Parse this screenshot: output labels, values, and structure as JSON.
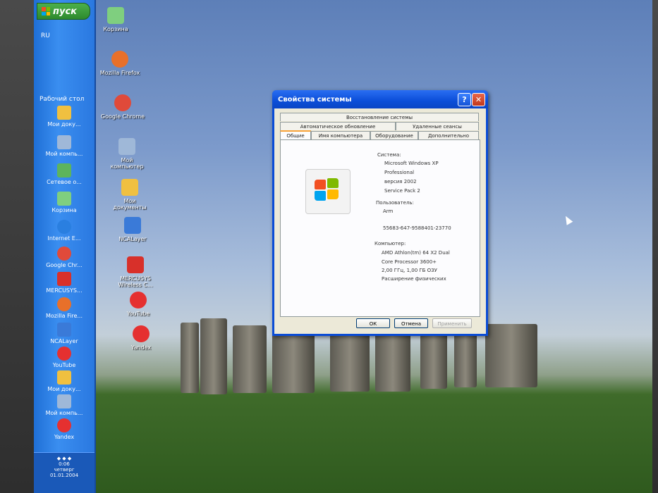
{
  "taskbar": {
    "start_label": "пуск",
    "lang": "RU",
    "desktop_label": "Рабочий стол",
    "items": [
      {
        "label": "Мои доку...",
        "color": "#f0c040"
      },
      {
        "label": "Мой компь...",
        "color": "#9fb8d8"
      },
      {
        "label": "Сетевое о...",
        "color": "#5db45d"
      },
      {
        "label": "Корзина",
        "color": "#7fcf7f"
      },
      {
        "label": "Internet E...",
        "color": "#2a7fe0"
      },
      {
        "label": "Google Chr...",
        "color": "#e04a3a"
      },
      {
        "label": "MERCUSYS...",
        "color": "#d8302a"
      },
      {
        "label": "Mozilla Fire...",
        "color": "#e8702a"
      },
      {
        "label": "NCALayer",
        "color": "#3a7ad8"
      },
      {
        "label": "YouTube",
        "color": "#e53030"
      },
      {
        "label": "Мои доку...",
        "color": "#f0c040"
      },
      {
        "label": "Мой компь...",
        "color": "#9fb8d8"
      },
      {
        "label": "Yandex",
        "color": "#e53030"
      }
    ],
    "tray": {
      "time": "0:06",
      "day": "четверг",
      "date": "01.01.2004"
    }
  },
  "desktop_icons": [
    {
      "label": "Корзина",
      "color": "#7fcf7f"
    },
    {
      "label": "Mozilla Firefox",
      "color": "#e8702a"
    },
    {
      "label": "Google Chrome",
      "color": "#e04a3a"
    },
    {
      "label": "Мой компьютер",
      "color": "#9fb8d8"
    },
    {
      "label": "Мои документы",
      "color": "#f0c040"
    },
    {
      "label": "NCALayer",
      "color": "#3a7ad8"
    },
    {
      "label": "MERCUSYS Wireless C...",
      "color": "#d8302a"
    },
    {
      "label": "YouTube",
      "color": "#e53030"
    },
    {
      "label": "Yandex",
      "color": "#e53030"
    }
  ],
  "dialog": {
    "title": "Свойства системы",
    "help_glyph": "?",
    "close_glyph": "✕",
    "tabs_row1": [
      "Восстановление системы"
    ],
    "tabs_row2": [
      "Автоматическое обновление",
      "Удаленные сеансы"
    ],
    "tabs_row3": [
      "Общие",
      "Имя компьютера",
      "Оборудование",
      "Дополнительно"
    ],
    "system_label": "Система:",
    "system_lines": [
      "Microsoft Windows XP",
      "Professional",
      "версия 2002",
      "Service Pack 2"
    ],
    "user_label": "Пользователь:",
    "user_name": "Arm",
    "product_id": "55683-647-9588401-23770",
    "computer_label": "Компьютер:",
    "computer_lines": [
      "AMD Athlon(tm) 64 X2 Dual",
      "Core Processor 3600+",
      "2,00 ГГц, 1,00 ГБ ОЗУ",
      "Расширение физических"
    ],
    "buttons": {
      "ok": "ОК",
      "cancel": "Отмена",
      "apply": "Применить"
    }
  }
}
